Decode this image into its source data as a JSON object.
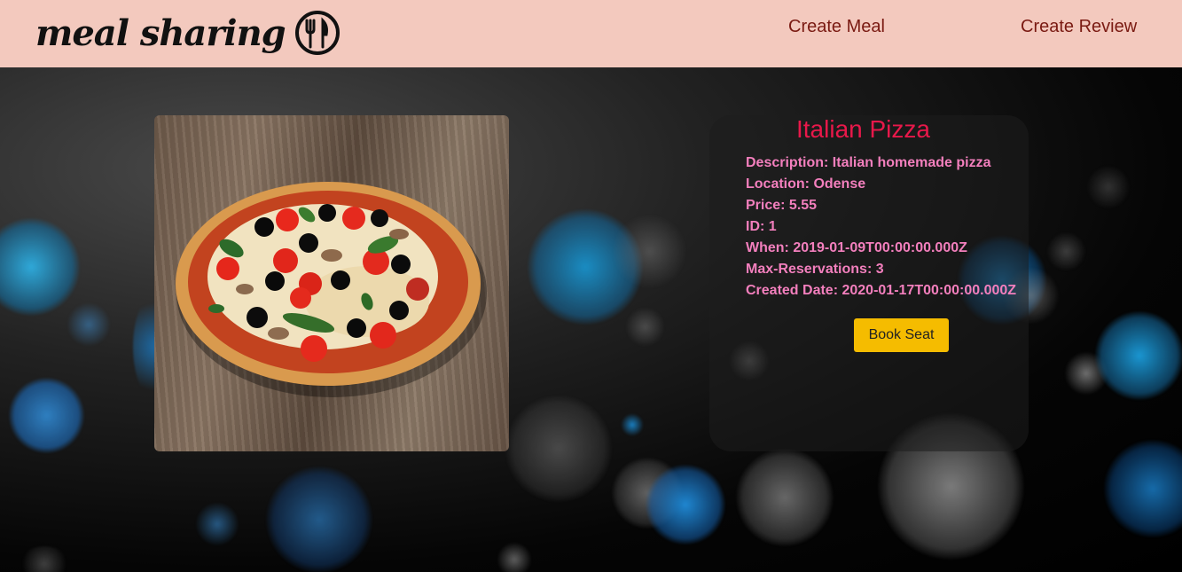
{
  "header": {
    "logo_text": "meal sharing",
    "nav": {
      "create_meal": "Create Meal",
      "create_review": "Create Review"
    },
    "bg_color": "#f3c9be",
    "link_color": "#7a1a12"
  },
  "meal": {
    "title": "Italian Pizza",
    "description": "Description: Italian homemade pizza",
    "location": "Location: Odense",
    "price": "Price: 5.55",
    "id": "ID: 1",
    "when": "When: 2019-01-09T00:00:00.000Z",
    "max_reservations": "Max-Reservations: 3",
    "created_date": "Created Date: 2020-01-17T00:00:00.000Z",
    "image_icon": "pizza-image"
  },
  "actions": {
    "book_seat": "Book Seat"
  },
  "colors": {
    "title": "#e8184a",
    "details": "#f37fbd",
    "button": "#f5bc00"
  }
}
